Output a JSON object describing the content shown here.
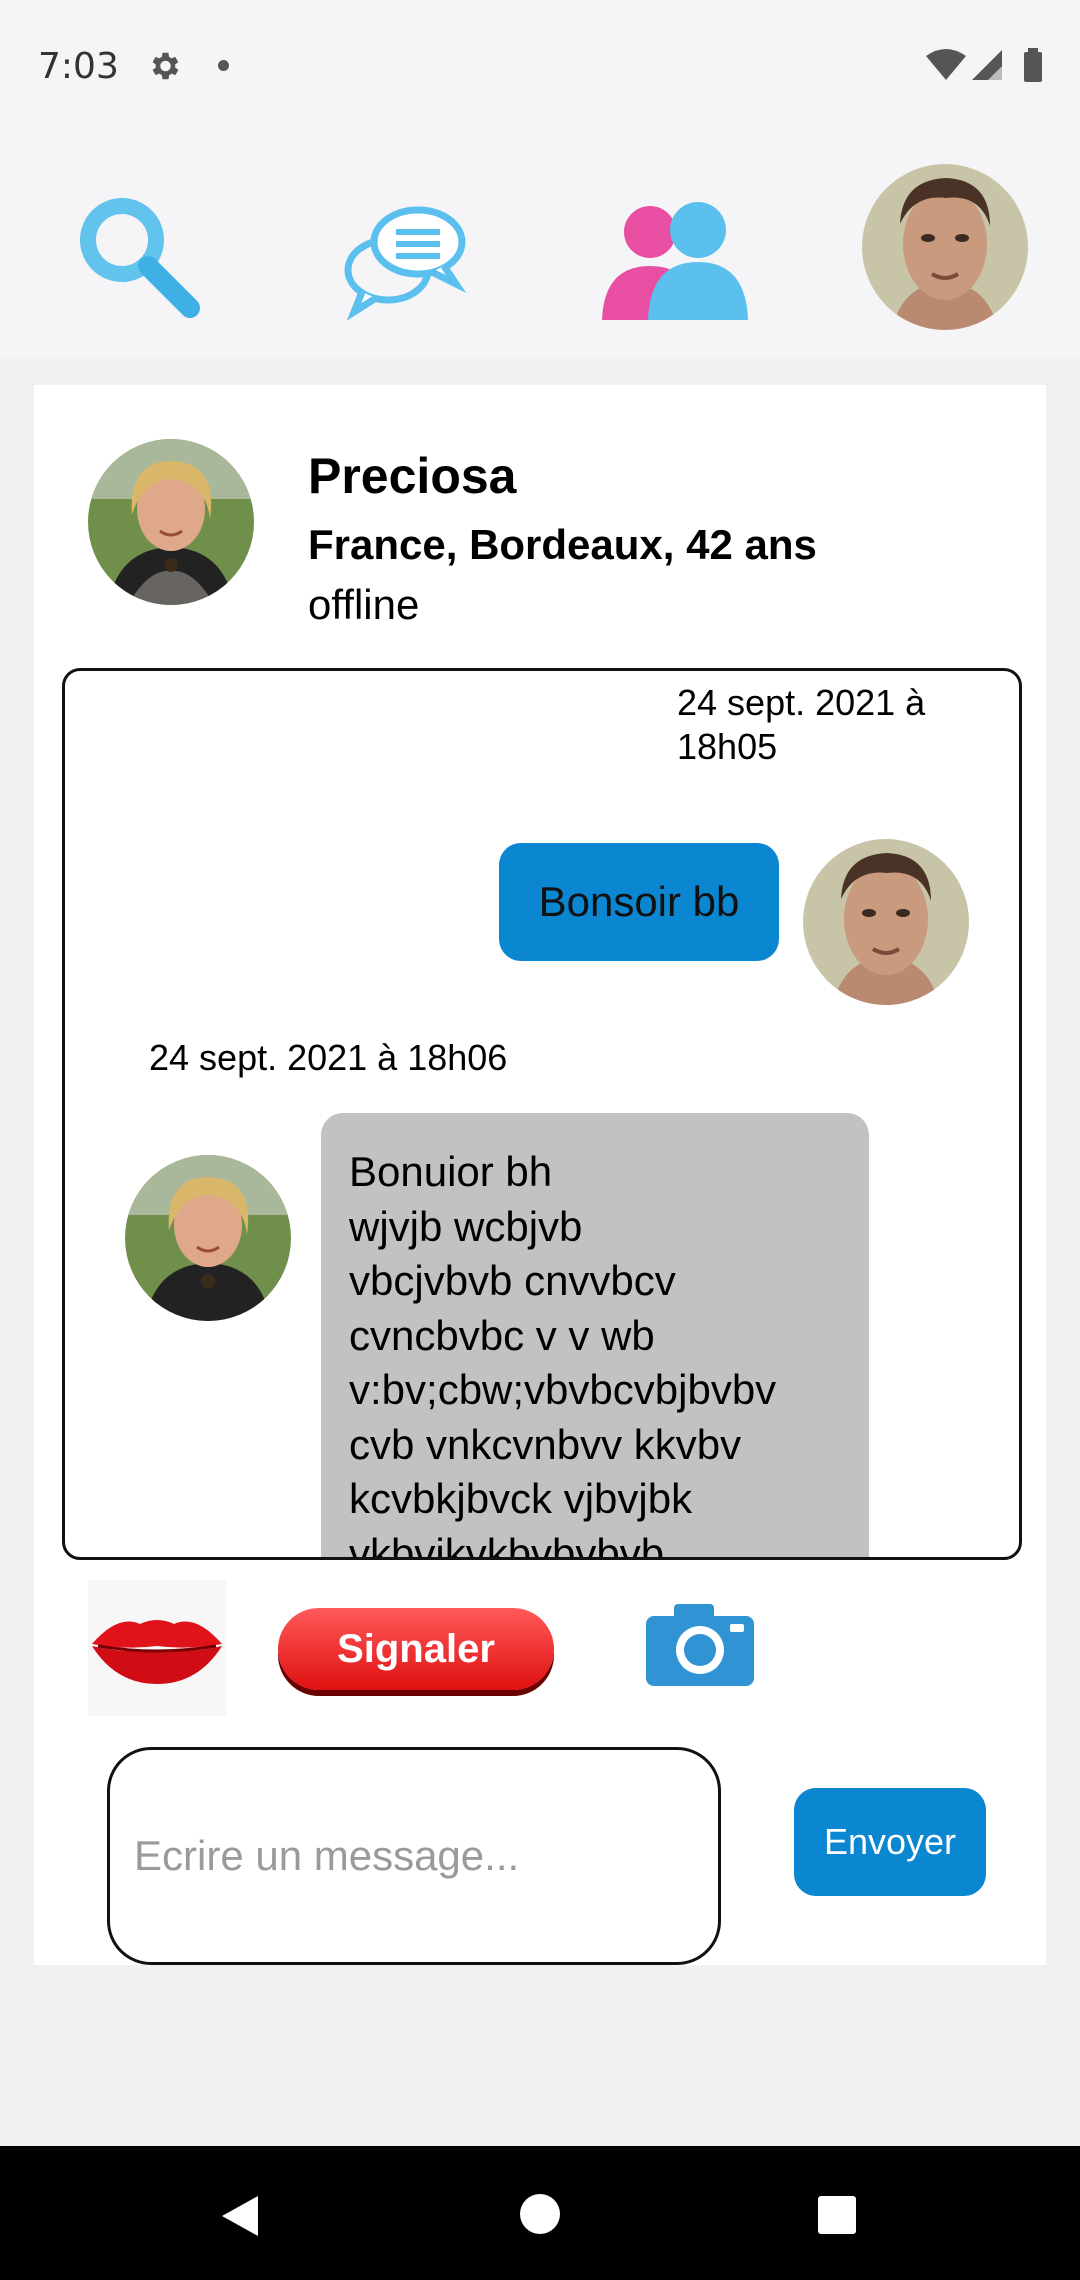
{
  "status_bar": {
    "time": "7:03"
  },
  "nav": {
    "icons": [
      "search-icon",
      "chat-icon",
      "users-icon",
      "profile-avatar"
    ]
  },
  "profile": {
    "name": "Preciosa",
    "location": "France, Bordeaux, 42 ans",
    "status": "offline"
  },
  "conversation": {
    "messages": [
      {
        "direction": "out",
        "timestamp": "24 sept. 2021 à 18h05",
        "text": "Bonsoir bb"
      },
      {
        "direction": "in",
        "timestamp": "24 sept. 2021 à 18h06",
        "text": "Bonuior bh\nwjvjb wcbjvb\nvbcjvbvb cnvvbcv\ncvncbvbc v v wb\nv:bv;cbw;vbvbcvbjbvbv\ncvb vnkcvnbvv kkvbv\nkcvbkjbvck vjbvjbk\nvkbvjkvkbvbvbvb"
      }
    ]
  },
  "actions": {
    "signaler_label": "Signaler",
    "icons": [
      "lips-icon",
      "camera-icon"
    ]
  },
  "composer": {
    "placeholder": "Ecrire un message...",
    "value": "",
    "send_label": "Envoyer"
  },
  "colors": {
    "accent": "#0b86d1",
    "incoming_bubble": "#c2c2c2",
    "users_icon_pink": "#e84fa3",
    "users_icon_blue": "#5bc0ee"
  }
}
